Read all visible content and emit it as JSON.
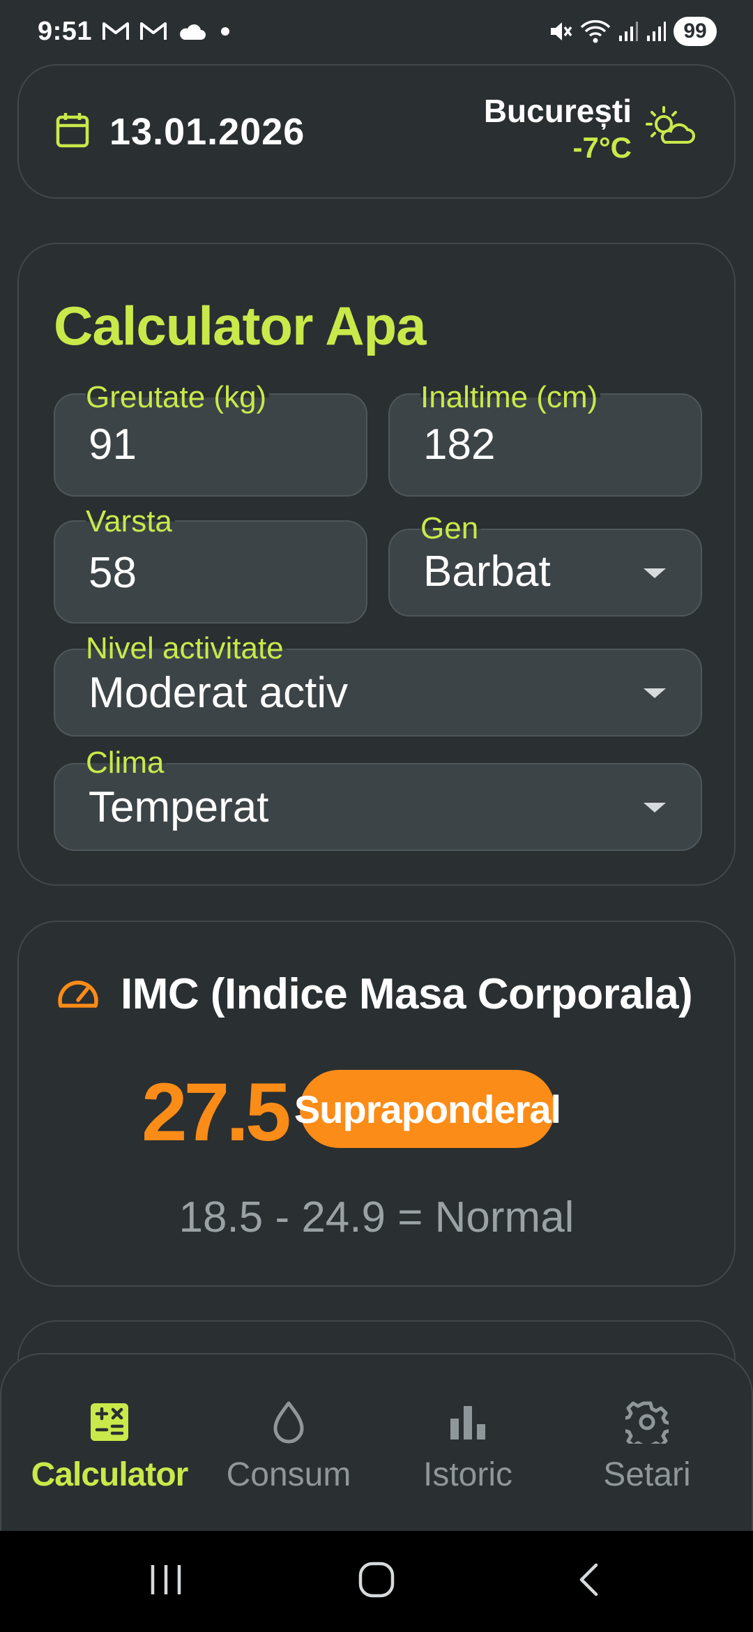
{
  "status_bar": {
    "time": "9:51",
    "notification_icons": [
      "gmail-icon",
      "gmail-icon",
      "cloud-icon",
      "dot-icon"
    ],
    "system_icons": [
      "mute-icon",
      "wifi-icon",
      "signal-icon",
      "signal-icon"
    ],
    "battery": "99"
  },
  "header": {
    "date": "13.01.2026",
    "city": "București",
    "temperature": "-7°C",
    "weather_icon": "partly-sunny-icon"
  },
  "calculator": {
    "title": "Calculator Apa",
    "weight": {
      "label": "Greutate (kg)",
      "value": "91"
    },
    "height": {
      "label": "Inaltime (cm)",
      "value": "182"
    },
    "age": {
      "label": "Varsta",
      "value": "58"
    },
    "gender": {
      "label": "Gen",
      "value": "Barbat"
    },
    "activity": {
      "label": "Nivel activitate",
      "value": "Moderat activ"
    },
    "climate": {
      "label": "Clima",
      "value": "Temperat"
    }
  },
  "imc": {
    "title": "IMC (Indice Masa Corporala)",
    "value": "27.5",
    "category": "Supraponderal",
    "normal_range": "18.5 - 24.9 = Normal"
  },
  "bottom_nav": {
    "items": [
      {
        "label": "Calculator",
        "icon": "calculator-icon",
        "active": true
      },
      {
        "label": "Consum",
        "icon": "water-drop-icon",
        "active": false
      },
      {
        "label": "Istoric",
        "icon": "bar-chart-icon",
        "active": false
      },
      {
        "label": "Setari",
        "icon": "gear-icon",
        "active": false
      }
    ]
  },
  "colors": {
    "accent": "#c9e94a",
    "warning": "#fb8c18",
    "background": "#2a2f32",
    "field": "#3d4448"
  }
}
